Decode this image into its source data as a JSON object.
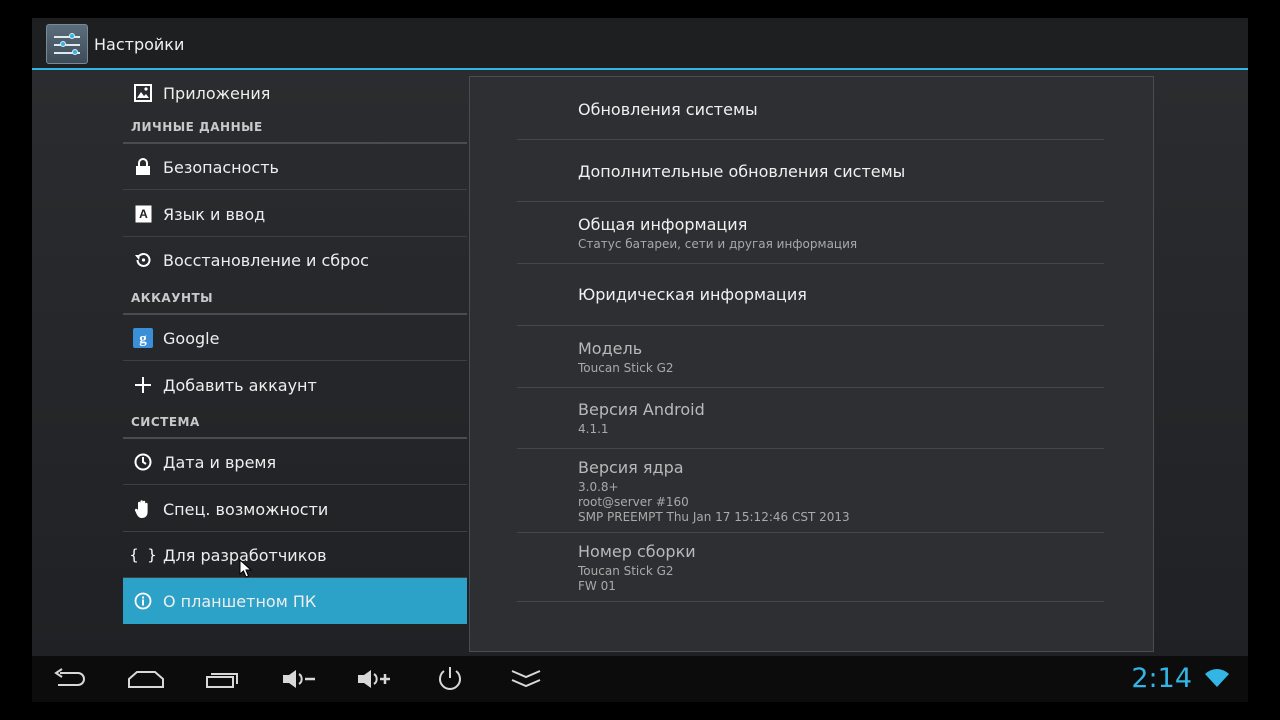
{
  "app": {
    "title": "Настройки"
  },
  "left": {
    "apps_label": "Приложения",
    "section_personal": "ЛИЧНЫЕ ДАННЫЕ",
    "security": "Безопасность",
    "language": "Язык и ввод",
    "backup": "Восстановление и сброс",
    "section_accounts": "АККАУНТЫ",
    "google": "Google",
    "add_account": "Добавить аккаунт",
    "section_system": "СИСТЕМА",
    "datetime": "Дата и время",
    "accessibility": "Спец. возможности",
    "developer": "Для разработчиков",
    "about": "О планшетном ПК"
  },
  "right": {
    "system_updates": "Обновления системы",
    "extra_updates": "Дополнительные обновления системы",
    "status_title": "Общая информация",
    "status_sub": "Статус батареи, сети и другая информация",
    "legal": "Юридическая информация",
    "model_title": "Модель",
    "model_value": "Toucan Stick G2",
    "android_title": "Версия Android",
    "android_value": "4.1.1",
    "kernel_title": "Версия ядра",
    "kernel_line1": "3.0.8+",
    "kernel_line2": "root@server #160",
    "kernel_line3": "SMP PREEMPT Thu Jan 17 15:12:46 CST 2013",
    "build_title": "Номер сборки",
    "build_line1": "Toucan Stick G2",
    "build_line2": "FW 01"
  },
  "status": {
    "time": "2:14"
  },
  "icons": {
    "apps": "image-icon",
    "security": "lock-icon",
    "language": "keyboard-a-icon",
    "backup": "restore-icon",
    "google": "google-icon",
    "add": "plus-icon",
    "datetime": "clock-icon",
    "accessibility": "hand-icon",
    "developer": "braces-icon",
    "about": "info-icon"
  },
  "colors": {
    "accent": "#33b5e5",
    "selected": "#2ca2c8"
  }
}
